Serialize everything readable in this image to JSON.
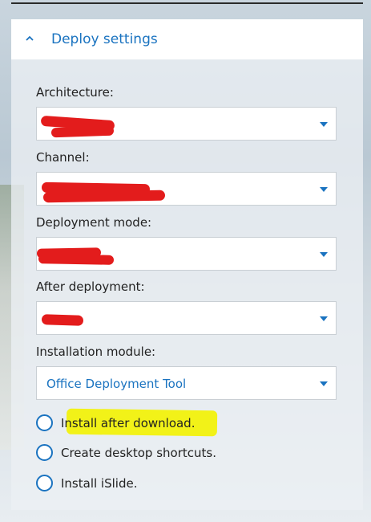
{
  "panel": {
    "title": "Deploy settings"
  },
  "fields": [
    {
      "label": "Architecture:",
      "value": ""
    },
    {
      "label": "Channel:",
      "value": ""
    },
    {
      "label": "Deployment mode:",
      "value": ""
    },
    {
      "label": "After deployment:",
      "value": ""
    },
    {
      "label": "Installation module:",
      "value": "Office Deployment Tool"
    }
  ],
  "options": [
    {
      "label": "Install after download.",
      "checked": false,
      "highlighted": true
    },
    {
      "label": "Create desktop shortcuts.",
      "checked": false,
      "highlighted": false
    },
    {
      "label": "Install iSlide.",
      "checked": false,
      "highlighted": false
    }
  ],
  "colors": {
    "accent": "#1a73c0",
    "redaction": "#e31c1c",
    "highlight": "#f2f218"
  },
  "icons": {
    "collapse": "chevron-up-icon",
    "dropdown": "caret-down-icon",
    "radio": "radio-unchecked-icon"
  }
}
